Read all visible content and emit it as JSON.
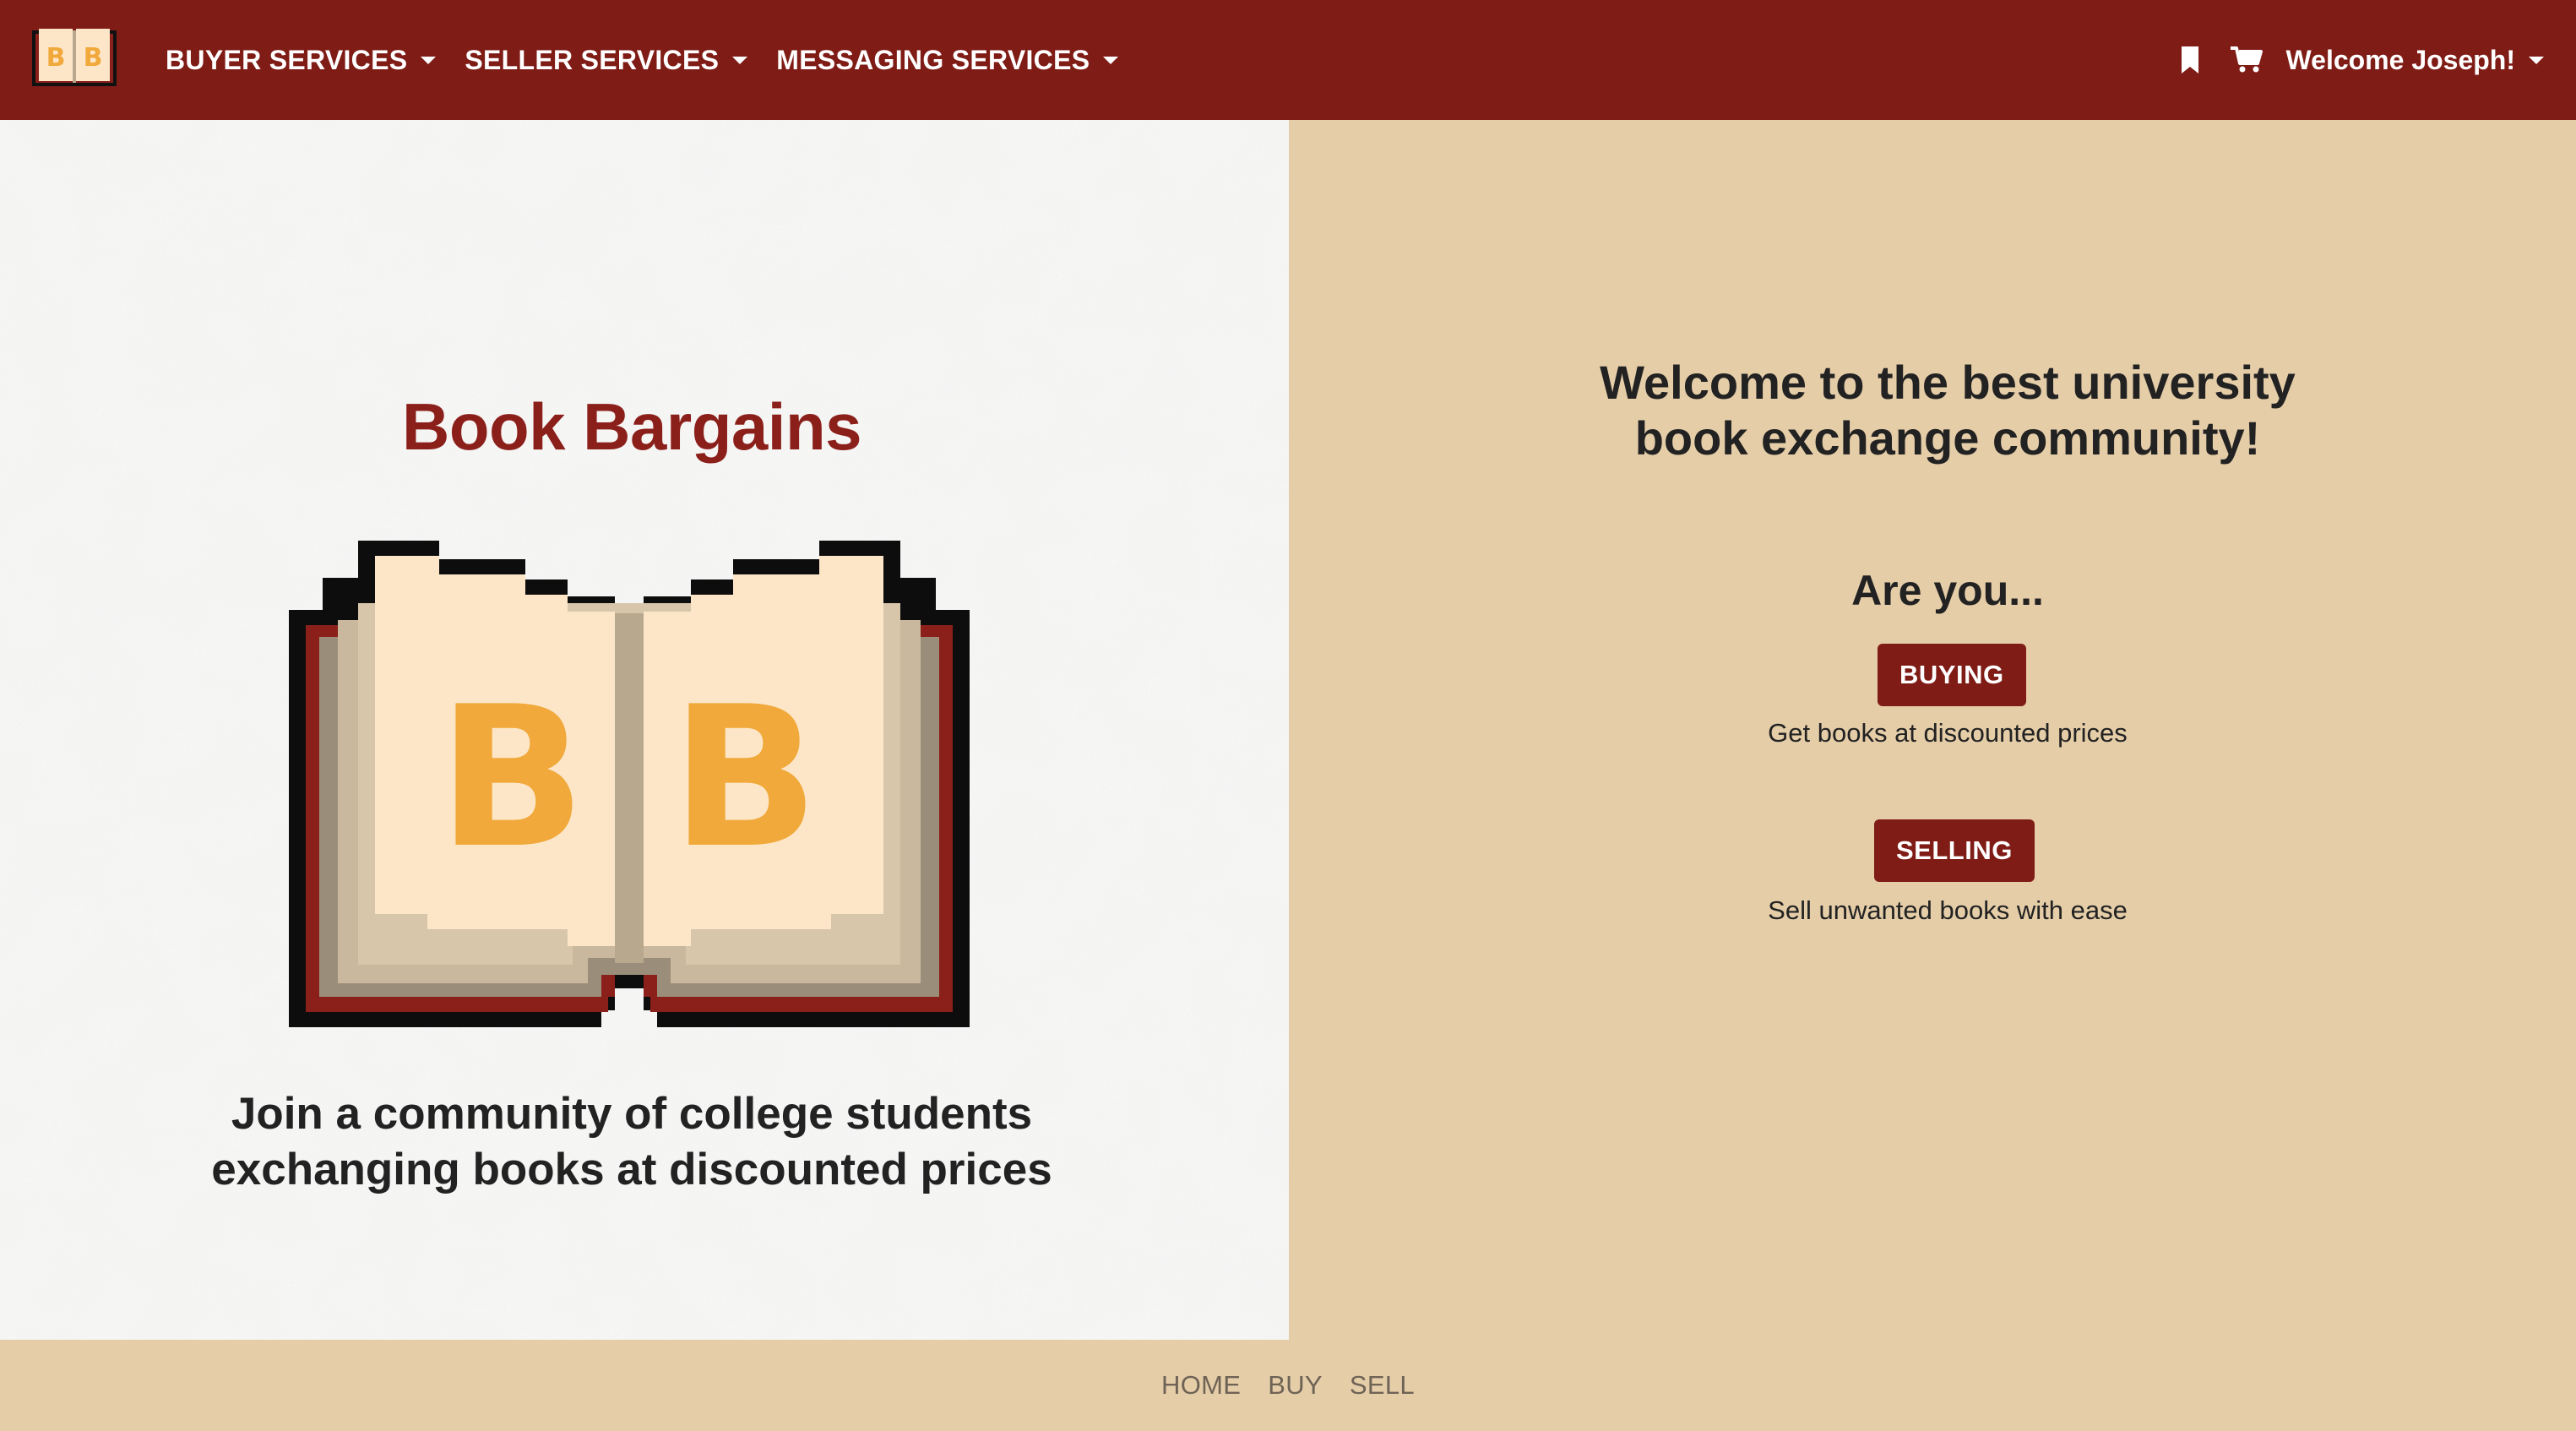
{
  "navbar": {
    "logo_letters": "BB",
    "menus": [
      {
        "label": "BUYER SERVICES"
      },
      {
        "label": "SELLER SERVICES"
      },
      {
        "label": "MESSAGING SERVICES"
      }
    ],
    "user_label": "Welcome Joseph!",
    "bookmark_icon": "bookmark-icon",
    "cart_icon": "cart-icon"
  },
  "hero": {
    "title": "Book Bargains",
    "logo_letters": "BB",
    "tagline_line1": "Join a community of college students",
    "tagline_line2": "exchanging books at discounted prices"
  },
  "intro": {
    "welcome_part1": "Welcome to the ",
    "welcome_bold": "best",
    "welcome_part2": " university",
    "welcome_line2": "book exchange community!",
    "prompt": "Are you...",
    "buying_label": "BUYING",
    "buying_desc": "Get books at discounted prices",
    "selling_label": "SELLING",
    "selling_desc": "Sell unwanted books with ease"
  },
  "footer": {
    "links": [
      "HOME",
      "BUY",
      "SELL"
    ]
  },
  "colors": {
    "brand": "#7f1c16",
    "background": "#e5cda8",
    "logo_letter": "#f0a93a"
  }
}
